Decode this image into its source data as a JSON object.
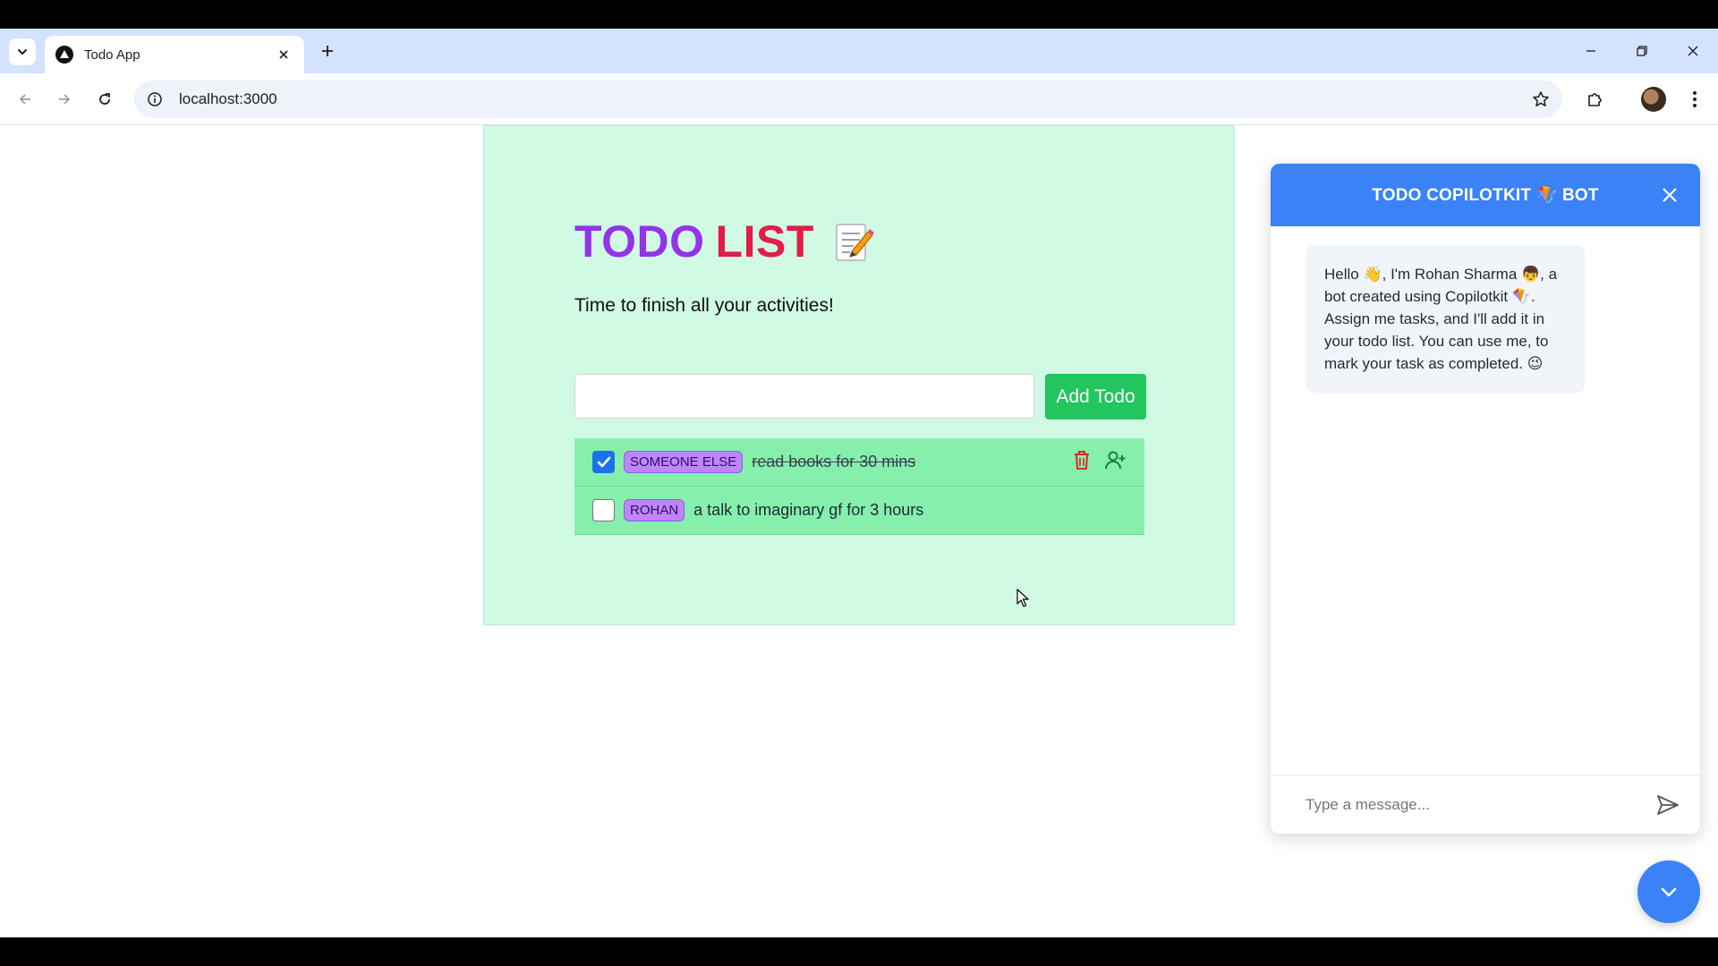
{
  "browser": {
    "tab_title": "Todo App",
    "url": "localhost:3000"
  },
  "todo": {
    "title_part1": "TODO",
    "title_part2": "LIST",
    "title_icon": "memo-icon",
    "subtitle": "Time to finish all your activities!",
    "input_value": "",
    "add_button_label": "Add Todo",
    "items": [
      {
        "assignee": "SOMEONE ELSE",
        "text": "read books for 30 mins",
        "completed": true
      },
      {
        "assignee": "ROHAN",
        "text": "a talk to imaginary gf for 3 hours",
        "completed": false
      }
    ]
  },
  "chat": {
    "title": "TODO COPILOTKIT 🪁 BOT",
    "bot_message": "Hello 👋, I'm Rohan Sharma 👦, a bot created using Copilotkit 🪁. Assign me tasks, and I'll add it in your todo list. You can use me, to mark your task as completed. 😉",
    "input_placeholder": "Type a message..."
  },
  "colors": {
    "card_bg": "#d1fae5",
    "title_purple": "#9333ea",
    "title_red": "#e11d48",
    "add_button": "#22c55e",
    "todo_row": "#86efac",
    "tag_bg": "#c084fc",
    "chat_accent": "#3b82f6"
  }
}
